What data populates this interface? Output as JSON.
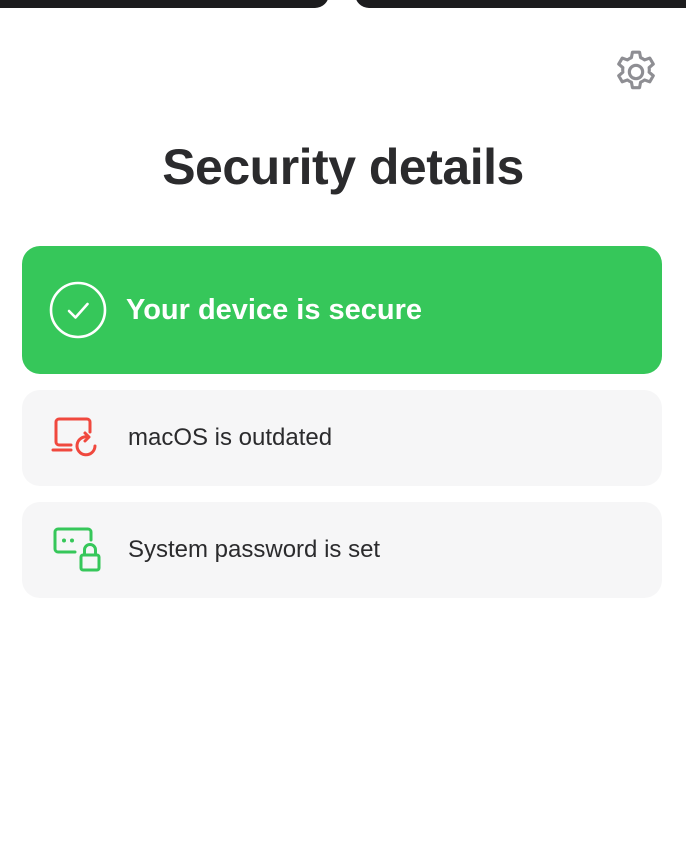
{
  "header": {
    "title": "Security details",
    "settings_icon": "gear-icon"
  },
  "status": {
    "label": "Your device is secure",
    "icon": "checkmark-circle-icon",
    "color": "#36c75a"
  },
  "details": [
    {
      "label": "macOS is outdated",
      "icon": "laptop-refresh-icon",
      "status": "warning",
      "icon_color": "#f0483e"
    },
    {
      "label": "System password is set",
      "icon": "password-lock-icon",
      "status": "ok",
      "icon_color": "#36c75a"
    }
  ],
  "colors": {
    "card_background": "#f6f6f7",
    "text_primary": "#2b2b2d",
    "icon_gray": "#8e8e93"
  }
}
